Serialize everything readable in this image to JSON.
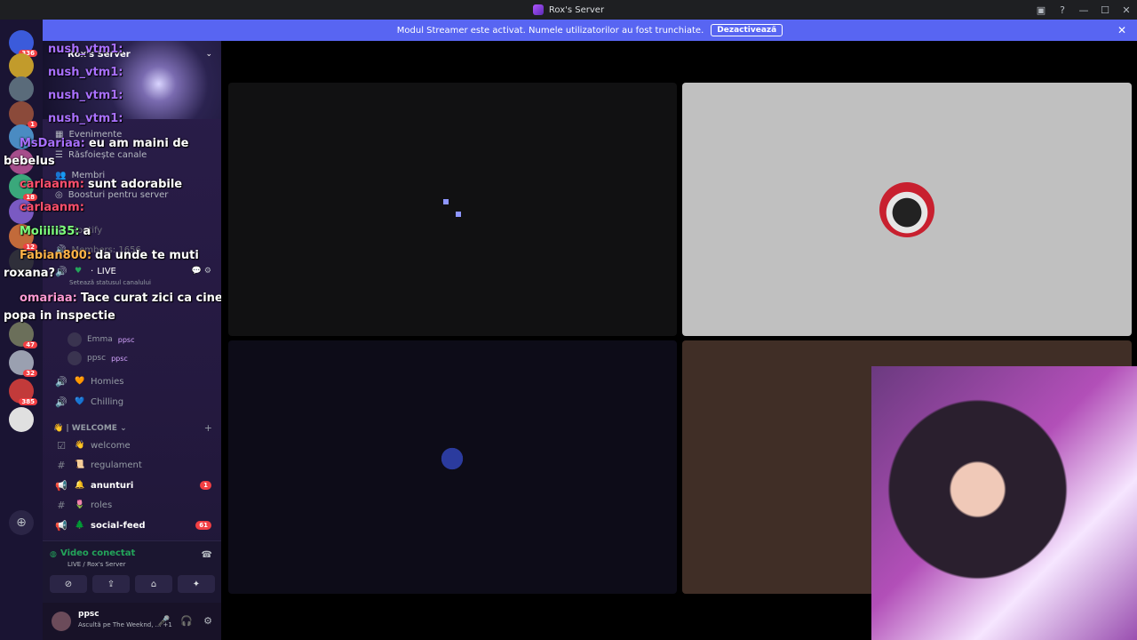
{
  "window": {
    "title": "Rox's Server",
    "controls": [
      "minimize",
      "maximize",
      "close"
    ]
  },
  "banner": {
    "text": "Modul Streamer este activat. Numele utilizatorilor au fost trunchiate.",
    "button": "Dezactivează",
    "close": "✕"
  },
  "guilds": [
    {
      "badge": "336"
    },
    {
      "badge": ""
    },
    {
      "badge": ""
    },
    {
      "badge": "1"
    },
    {
      "badge": ""
    },
    {
      "badge": ""
    },
    {
      "badge": "18"
    },
    {
      "badge": ""
    },
    {
      "badge": "12"
    },
    {
      "badge": ""
    },
    {
      "badge": "47"
    },
    {
      "badge": "32"
    },
    {
      "badge": "385"
    },
    {
      "badge": ""
    }
  ],
  "sidebar": {
    "server_name": "Rox's Server",
    "nav": [
      {
        "label": "Evenimente",
        "icon": "calendar-icon"
      },
      {
        "label": "Răsfoiește canale",
        "icon": "browse-icon"
      },
      {
        "label": "Membri",
        "icon": "members-icon"
      },
      {
        "label": "Boosturi pentru server",
        "icon": "boost-icon"
      }
    ],
    "hidden_rows": [
      "Members: 1656",
      "Spotify"
    ],
    "live_channel": {
      "dot": "·",
      "name": "LIVE",
      "status_hint": "Setează statusul canalului"
    },
    "voice_users": [
      {
        "name": "Emma",
        "tag": "ppsc"
      },
      {
        "name": "ppsc",
        "tag": "ppsc"
      }
    ],
    "voice_channels": [
      {
        "emoji": "🧡",
        "name": "Homies"
      },
      {
        "emoji": "💙",
        "name": "Chilling"
      }
    ],
    "category": "👋 | WELCOME",
    "text_channels": [
      {
        "emoji": "👋",
        "name": "welcome",
        "unread": false,
        "badge": ""
      },
      {
        "emoji": "📜",
        "name": "regulament",
        "unread": false,
        "badge": ""
      },
      {
        "emoji": "🔔",
        "name": "anunturi",
        "unread": true,
        "badge": "1"
      },
      {
        "emoji": "🌷",
        "name": "roles",
        "unread": false,
        "badge": ""
      },
      {
        "emoji": "🌲",
        "name": "social-feed",
        "unread": true,
        "badge": "61"
      }
    ]
  },
  "voice_panel": {
    "status": "Video conectat",
    "location": "LIVE / Rox's Server",
    "buttons": [
      "camera-off",
      "share-screen",
      "activity",
      "soundboard"
    ]
  },
  "user_panel": {
    "name": "ppsc",
    "activity": "Ascultă pe The Weeknd, ... +1"
  },
  "chat_overlay": [
    {
      "user": "nush_vtm1:",
      "msg": "",
      "color": "#a970ff"
    },
    {
      "user": "nush_vtm1:",
      "msg": "",
      "color": "#a970ff"
    },
    {
      "user": "nush_vtm1:",
      "msg": "",
      "color": "#a970ff"
    },
    {
      "user": "nush_vtm1:",
      "msg": "",
      "color": "#a970ff"
    },
    {
      "user": "MsDariaa:",
      "msg": "eu am maini de",
      "color": "#a970ff"
    },
    {
      "user": "",
      "msg": "bebelus",
      "color": "#ffffff"
    },
    {
      "user": "carlaanm:",
      "msg": "sunt adorabile",
      "color": "#ff4f6d"
    },
    {
      "user": "carlaanm:",
      "msg": "",
      "color": "#ff4f6d"
    },
    {
      "user": "Moiiiii35:",
      "msg": "a",
      "color": "#7dff7d"
    },
    {
      "user": "Fabian800:",
      "msg": "da unde te muti",
      "color": "#ffb347"
    },
    {
      "user": "",
      "msg": "roxana?",
      "color": "#ffffff"
    },
    {
      "user": "omariaa:",
      "msg": "Tace curat zici ca cine",
      "color": "#ff9ad5"
    },
    {
      "user": "",
      "msg": "popa in inspectie",
      "color": "#ffffff"
    }
  ],
  "colors": {
    "accent": "#5865f2",
    "online": "#23a55a",
    "badge": "#f23f43"
  }
}
